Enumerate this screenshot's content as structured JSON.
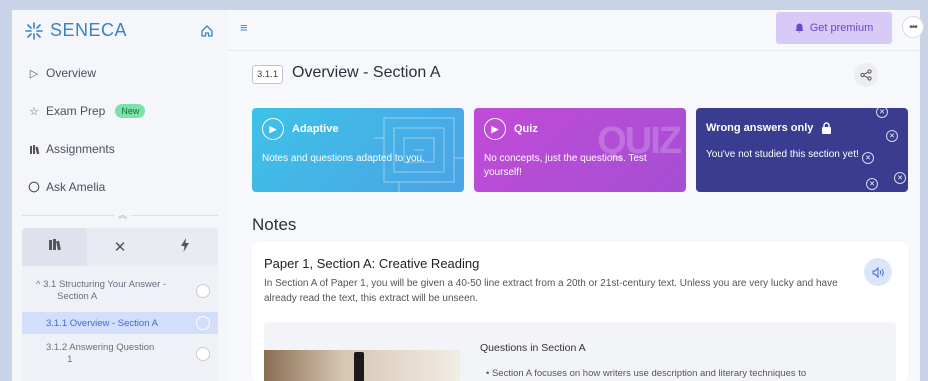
{
  "sidebar": {
    "logo": "SENECA",
    "nav": [
      {
        "label": "Overview",
        "icon": "triangle-play-icon"
      },
      {
        "label": "Exam Prep",
        "icon": "star-icon",
        "badge": "New"
      },
      {
        "label": "Assignments",
        "icon": "books-icon"
      },
      {
        "label": "Ask Amelia",
        "icon": "chat-bubble-icon"
      }
    ],
    "tabs": [
      {
        "icon": "books-icon",
        "glyph": "📚"
      },
      {
        "icon": "close-icon",
        "glyph": "✕"
      },
      {
        "icon": "lightning-icon",
        "glyph": "⚡"
      }
    ],
    "toc": [
      {
        "label": "^ 3.1 Structuring Your Answer -\n        Section A",
        "active": false
      },
      {
        "label": "3.1.1 Overview - Section A",
        "active": true
      },
      {
        "label": "3.1.2 Answering Question\n        1",
        "active": false
      }
    ]
  },
  "header": {
    "premium_label": "Get premium",
    "more_label": "•••"
  },
  "section": {
    "tag": "3.1.1",
    "title": "Overview - Section A"
  },
  "cards": [
    {
      "title": "Adaptive",
      "desc": "Notes and questions adapted to you."
    },
    {
      "title": "Quiz",
      "desc": "No concepts, just the questions. Test yourself!",
      "deco": "QUIZ"
    },
    {
      "title": "Wrong answers only",
      "desc": "You've not studied this section yet!"
    }
  ],
  "notes": {
    "heading": "Notes",
    "title": "Paper 1, Section A: Creative Reading",
    "body": "In Section A of Paper 1, you will be given a 40-50 line extract from a 20th or 21st-century text. Unless you are very lucky and have already read the text, this extract will be unseen.",
    "inner_title": "Questions in Section A",
    "bullet": "•  Section A focuses on how writers use description and literary techniques to"
  },
  "colors": {
    "accent": "#3b82c4",
    "premium_bg": "#d9c9f6",
    "adaptive": "#3ec2e8",
    "quiz": "#c14bd6",
    "wrong": "#3a3d8f"
  }
}
